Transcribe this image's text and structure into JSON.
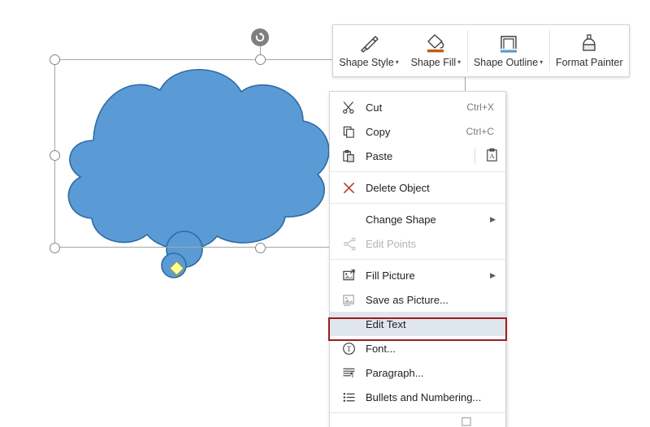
{
  "app": {
    "surface": "powerpoint-slide-canvas"
  },
  "shape": {
    "name": "cloud-shape",
    "fill_color": "#5b9bd5",
    "outline_color": "#2e5f8a",
    "selected": true,
    "handles": {
      "rotation_handle": "rotate-icon",
      "adjust_handle_color": "#ffff99",
      "resize_handle_color": "#ffffff"
    }
  },
  "mini_toolbar": {
    "buttons": [
      {
        "label": "Shape Style",
        "icon": "brush-icon",
        "has_dropdown": true
      },
      {
        "label": "Shape Fill",
        "icon": "paint-bucket-icon",
        "has_dropdown": true,
        "swatch_color": "#c55a11"
      },
      {
        "label": "Shape Outline",
        "icon": "outline-rect-icon",
        "has_dropdown": true,
        "swatch_color": "#5b9bd5"
      },
      {
        "label": "Format Painter",
        "icon": "format-painter-icon",
        "has_dropdown": false
      }
    ],
    "dropdown_caret": "▾"
  },
  "context_menu": {
    "items": [
      {
        "label": "Cut",
        "icon": "scissors-icon",
        "accel": "Ctrl+X",
        "disabled": false,
        "submenu": false
      },
      {
        "label": "Copy",
        "icon": "copy-icon",
        "accel": "Ctrl+C",
        "disabled": false,
        "submenu": false
      },
      {
        "label": "Paste",
        "icon": "paste-icon",
        "accel": "",
        "disabled": false,
        "submenu": false,
        "right_icon": "paste-keep-text-icon"
      },
      {
        "label": "Delete Object",
        "icon": "delete-x-icon",
        "accel": "",
        "disabled": false,
        "submenu": false
      },
      {
        "label": "Change Shape",
        "icon": "",
        "accel": "",
        "disabled": false,
        "submenu": true
      },
      {
        "label": "Edit Points",
        "icon": "edit-points-icon",
        "accel": "",
        "disabled": true,
        "submenu": false
      },
      {
        "label": "Fill Picture",
        "icon": "fill-picture-icon",
        "accel": "",
        "disabled": false,
        "submenu": true
      },
      {
        "label": "Save as Picture...",
        "icon": "save-picture-icon",
        "accel": "",
        "disabled": false,
        "submenu": false
      },
      {
        "label": "Edit Text",
        "icon": "",
        "accel": "",
        "disabled": false,
        "submenu": false,
        "highlighted": true
      },
      {
        "label": "Font...",
        "icon": "font-circle-t-icon",
        "accel": "",
        "disabled": false,
        "submenu": false
      },
      {
        "label": "Paragraph...",
        "icon": "paragraph-icon",
        "accel": "",
        "disabled": false,
        "submenu": false
      },
      {
        "label": "Bullets and Numbering...",
        "icon": "bullets-icon",
        "accel": "",
        "disabled": false,
        "submenu": false
      }
    ],
    "annotation": {
      "target_label": "Edit Text",
      "border_color": "#9e1b1b"
    }
  }
}
